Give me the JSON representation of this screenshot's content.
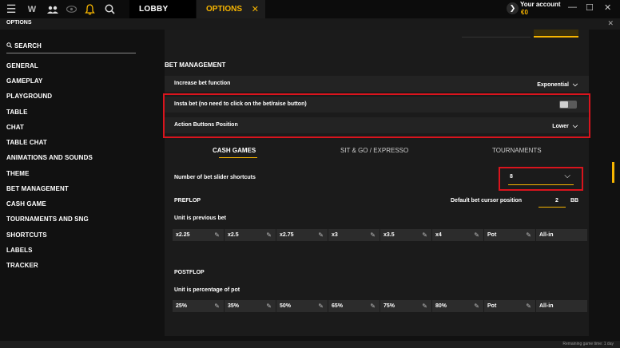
{
  "topbar": {
    "lobby_tab": "LOBBY",
    "options_tab": "OPTIONS",
    "account_label": "Your account",
    "account_balance": "€0",
    "accent_color": "#f7b500"
  },
  "window": {
    "title": "OPTIONS"
  },
  "sidebar": {
    "search_label": "SEARCH",
    "items": [
      "GENERAL",
      "GAMEPLAY",
      "PLAYGROUND",
      "TABLE",
      "CHAT",
      "TABLE CHAT",
      "ANIMATIONS AND SOUNDS",
      "THEME",
      "BET MANAGEMENT",
      "CASH GAME",
      "TOURNAMENTS AND SNG",
      "SHORTCUTS",
      "LABELS",
      "TRACKER"
    ]
  },
  "bet_management": {
    "title": "BET MANAGEMENT",
    "increase_bet_label": "Increase bet function",
    "increase_bet_value": "Exponential",
    "insta_bet_label": "Insta bet (no need to click on the bet/raise button)",
    "insta_bet_enabled": false,
    "action_buttons_label": "Action Buttons Position",
    "action_buttons_value": "Lower"
  },
  "game_tabs": [
    "CASH GAMES",
    "SIT & GO / EXPRESSO",
    "TOURNAMENTS"
  ],
  "shortcuts": {
    "label": "Number of bet slider shortcuts",
    "value": "8"
  },
  "preflop": {
    "title": "PREFLOP",
    "cursor_label": "Default bet cursor position",
    "cursor_value": "2",
    "cursor_unit": "BB",
    "unit_label": "Unit is previous bet",
    "chips": [
      "x2.25",
      "x2.5",
      "x2.75",
      "x3",
      "x3.5",
      "x4",
      "Pot",
      "All-in"
    ]
  },
  "postflop": {
    "title": "POSTFLOP",
    "unit_label": "Unit is percentage of pot",
    "chips": [
      "25%",
      "35%",
      "50%",
      "65%",
      "75%",
      "80%",
      "Pot",
      "All-in"
    ]
  },
  "footer": {
    "remaining": "Remaining game time: 1 day"
  }
}
